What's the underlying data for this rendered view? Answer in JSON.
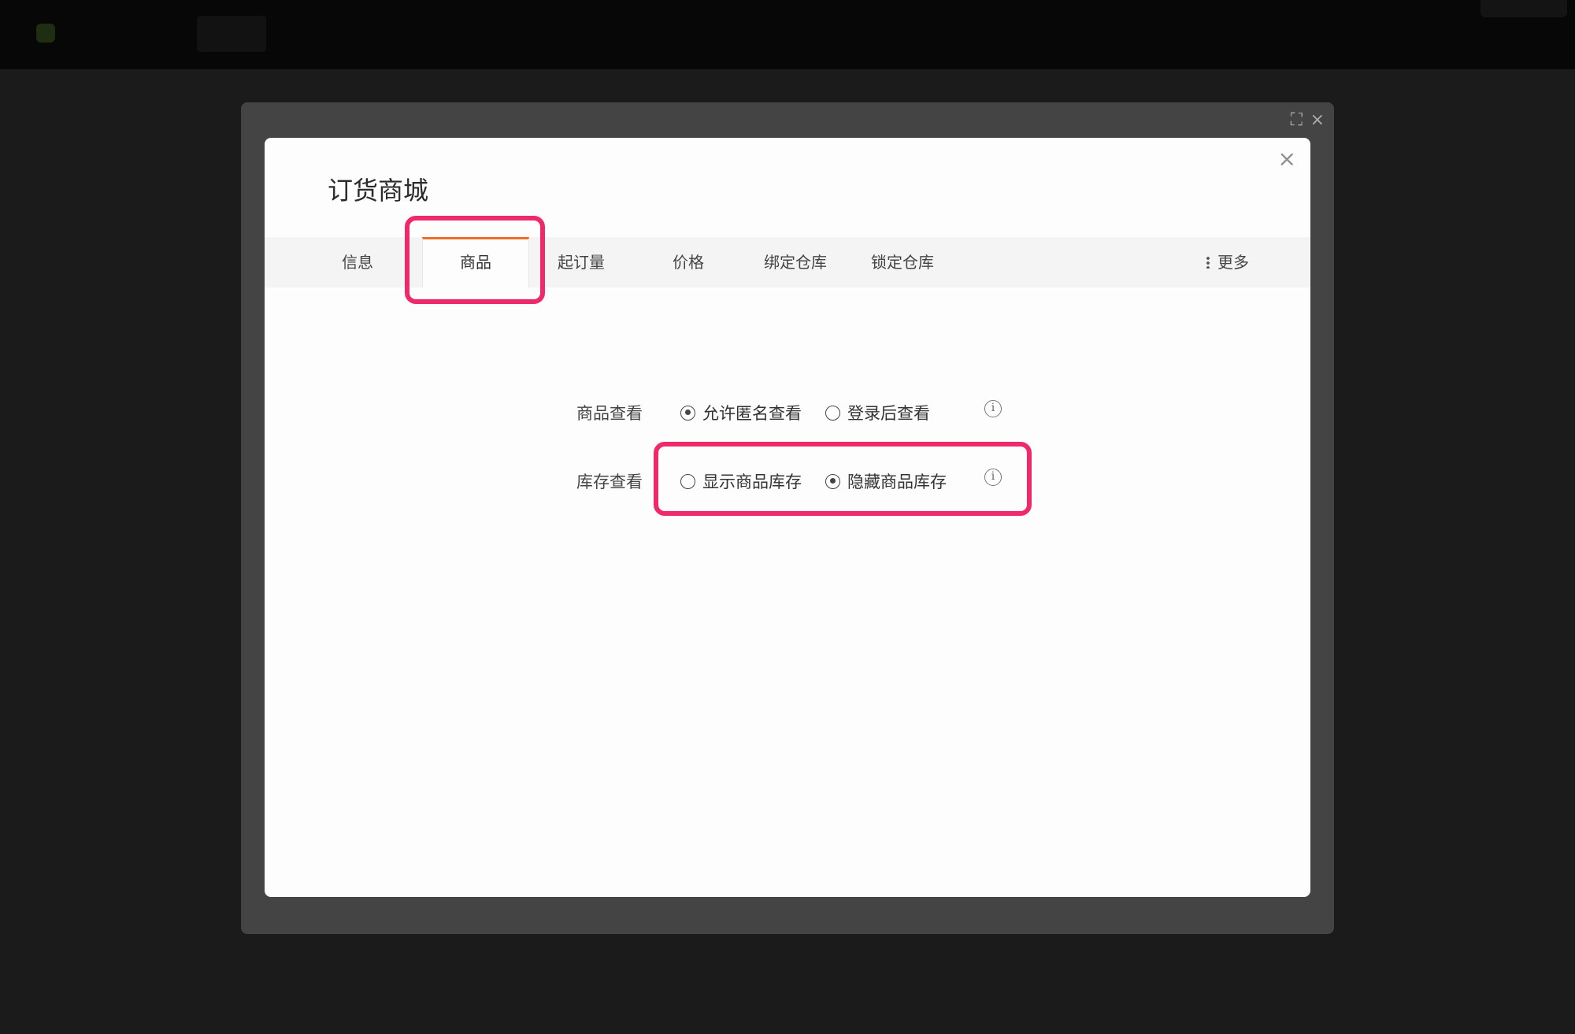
{
  "dialog": {
    "title": "订货商城",
    "tabs": [
      "信息",
      "商品",
      "起订量",
      "价格",
      "绑定仓库",
      "锁定仓库"
    ],
    "active_tab": "商品",
    "more_label": "更多"
  },
  "form": {
    "product_view": {
      "label": "商品查看",
      "options": [
        "允许匿名查看",
        "登录后查看"
      ],
      "selected": "允许匿名查看"
    },
    "stock_view": {
      "label": "库存查看",
      "options": [
        "显示商品库存",
        "隐藏商品库存"
      ],
      "selected": "隐藏商品库存"
    },
    "info_icon_glyph": "i"
  },
  "colors": {
    "accent_tab": "#ee6d2b",
    "highlight": "#ee2a6b"
  },
  "icons": [
    "close-icon",
    "fullscreen-icon",
    "info-icon",
    "more-dots-icon"
  ]
}
